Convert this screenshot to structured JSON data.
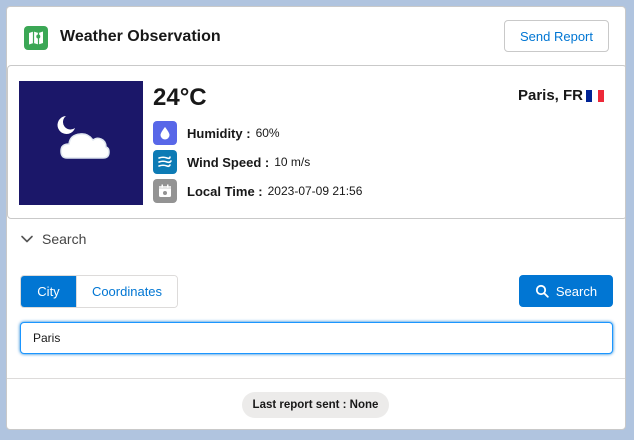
{
  "header": {
    "app_icon": "map-icon",
    "title": "Weather Observation",
    "send_report_label": "Send Report"
  },
  "weather": {
    "condition_icon": "moon-cloud-icon",
    "temperature": "24°C",
    "location": "Paris, FR",
    "flag_colors": [
      "#002395",
      "#ffffff",
      "#ed2939"
    ],
    "humidity": {
      "icon": "water-drop-icon",
      "label": "Humidity :",
      "value": "60%",
      "color": "#5867e8"
    },
    "wind": {
      "icon": "wind-icon",
      "label": "Wind Speed :",
      "value": "10 m/s",
      "color": "#0d7bb5"
    },
    "time": {
      "icon": "calendar-icon",
      "label": "Local Time :",
      "value": "2023-07-09 21:56",
      "color": "#939393"
    }
  },
  "search": {
    "section_label": "Search",
    "modes": {
      "city": "City",
      "coordinates": "Coordinates"
    },
    "active_mode": "City",
    "button_label": "Search",
    "input_value": "Paris"
  },
  "footer": {
    "status": "Last report sent : None"
  },
  "colors": {
    "brand": "#0176d3",
    "app_icon_bg": "#3ba755",
    "weather_bg": "#1b1769",
    "page_bg": "#b0c4df"
  }
}
